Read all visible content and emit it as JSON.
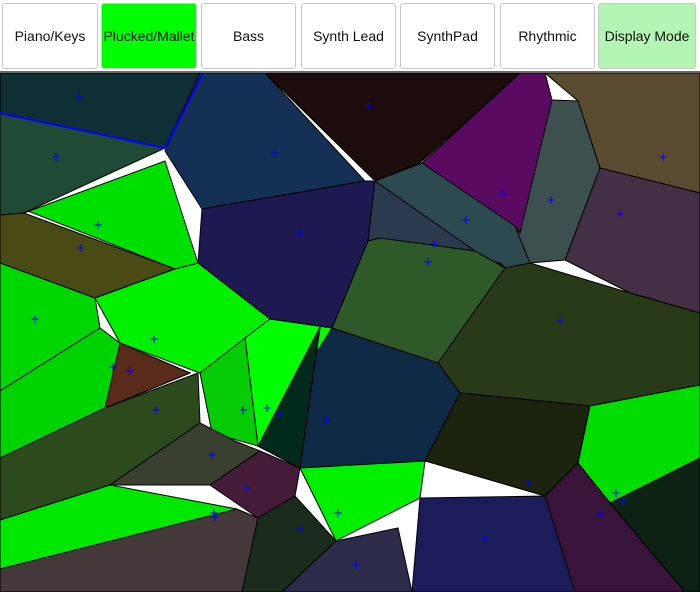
{
  "toolbar": {
    "buttons": [
      {
        "label": "Piano/Keys",
        "color": "#ffffff"
      },
      {
        "label": "Plucked/Mallet",
        "color": "#00ff00"
      },
      {
        "label": "Bass",
        "color": "#ffffff"
      },
      {
        "label": "Synth Lead",
        "color": "#ffffff"
      },
      {
        "label": "SynthPad",
        "color": "#ffffff"
      },
      {
        "label": "Rhythmic",
        "color": "#ffffff"
      },
      {
        "label": "Display Mode",
        "color": "#b3f5b3"
      }
    ]
  },
  "colors": {
    "cell_border": "#000000",
    "site_marker": "#0000ff",
    "highlight_edge": "#0000ff",
    "cells": [
      "#0f2f35",
      "#153055",
      "#1c0c0c",
      "#5a0a60",
      "#5a4a30",
      "#1f4a35",
      "#1c1a50",
      "#2d4a50",
      "#234a46",
      "#2c3a50",
      "#3c5050",
      "#443044",
      "#00e000",
      "#4a4a14",
      "#2d5a28",
      "#00d600",
      "#283a18",
      "#00f000",
      "#00d400",
      "#00ff00",
      "#06cc06",
      "#5a2a1a",
      "#2d4a1c",
      "#0f2a46",
      "#003c2a",
      "#3a4030",
      "#1c2410",
      "#441c3a",
      "#00e800",
      "#00f000",
      "#44383a",
      "#00dd00",
      "#1c2c1c",
      "#1c1c5a",
      "#2c2c4a",
      "#38143a",
      "#0e2214",
      "#002a1c"
    ]
  }
}
